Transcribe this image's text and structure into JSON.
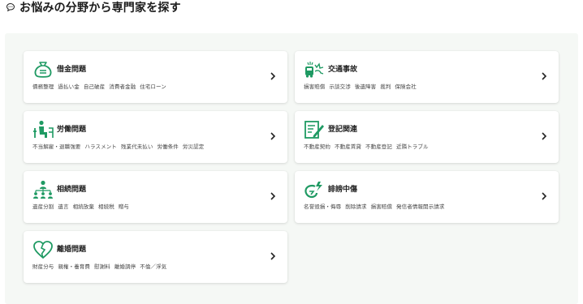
{
  "header": {
    "title": "お悩みの分野から専門家を探す",
    "icon": "chat-bubble-icon"
  },
  "colors": {
    "accent": "#1f9a63",
    "panel_bg": "#f5f8f5"
  },
  "categories": [
    {
      "title": "借金問題",
      "icon": "money-bag-icon",
      "tags": [
        "債務整理",
        "過払い金",
        "自己破産",
        "消費者金融",
        "住宅ローン"
      ]
    },
    {
      "title": "交通事故",
      "icon": "car-crash-icon",
      "tags": [
        "損害賠償",
        "示談交渉",
        "後遺障害",
        "裁判",
        "保険会社"
      ]
    },
    {
      "title": "労働問題",
      "icon": "worker-icon",
      "tags": [
        "不当解雇・退職強要",
        "ハラスメント",
        "残業代未払い",
        "労働条件",
        "労災認定"
      ]
    },
    {
      "title": "登記関連",
      "icon": "document-pen-icon",
      "tags": [
        "不動産契約",
        "不動産賃貸",
        "不動産登記",
        "近隣トラブル"
      ]
    },
    {
      "title": "相続問題",
      "icon": "family-tree-icon",
      "tags": [
        "遺産分割",
        "遺言",
        "相続放棄",
        "相続税",
        "贈与"
      ]
    },
    {
      "title": "誹謗中傷",
      "icon": "lightning-speech-icon",
      "tags": [
        "名誉毀損・侮辱",
        "削除請求",
        "損害賠償",
        "発信者情報開示請求"
      ]
    },
    {
      "title": "離婚問題",
      "icon": "broken-heart-icon",
      "tags": [
        "財産分与",
        "親権・養育費",
        "慰謝料",
        "離婚調停",
        "不倫／浮気"
      ]
    }
  ]
}
